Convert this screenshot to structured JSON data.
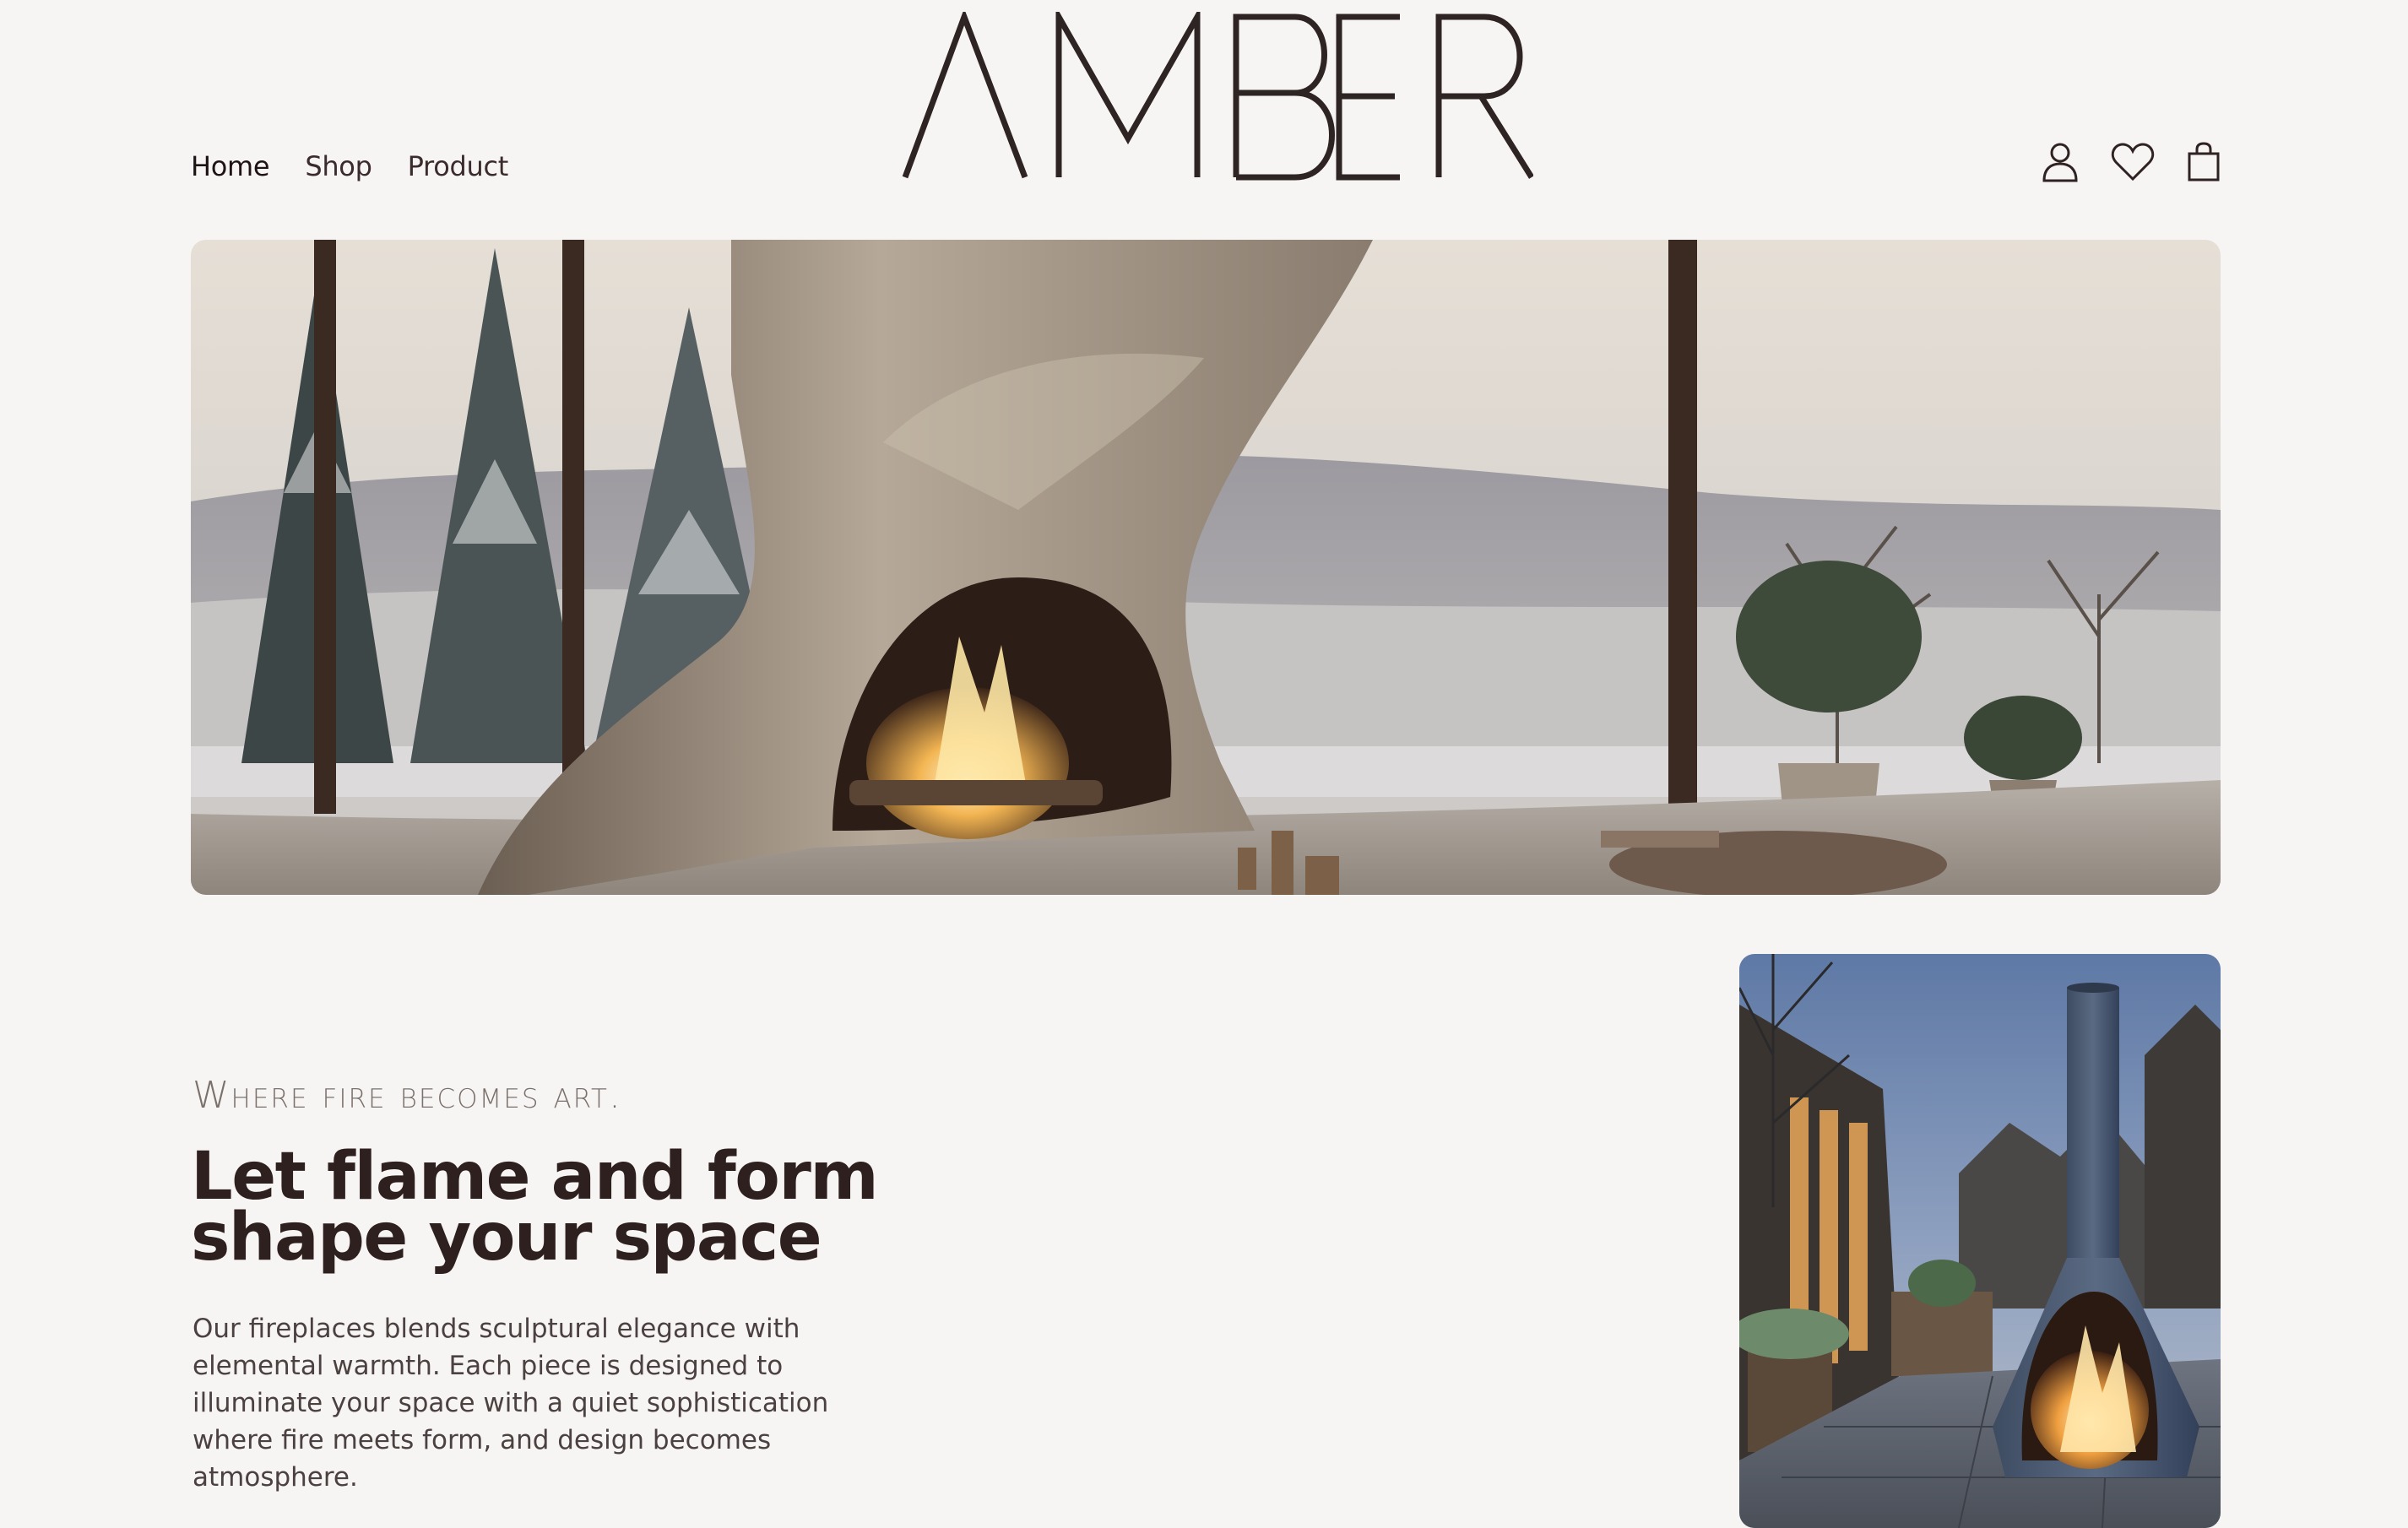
{
  "brand": {
    "logo_text": "AMBER"
  },
  "nav": {
    "items": [
      {
        "label": "Home",
        "active": true
      },
      {
        "label": "Shop",
        "active": false
      },
      {
        "label": "Product",
        "active": false
      }
    ]
  },
  "actions": {
    "icons": [
      "user-icon",
      "heart-icon",
      "shopping-bag-icon"
    ]
  },
  "intro": {
    "tagline": "Where fire becomes art.",
    "headline_line1": "Let flame and form",
    "headline_line2": "shape your space",
    "body": "Our fireplaces blends sculptural elegance with elemental warmth. Each piece is designed to illuminate your space with a quiet sophistication  where fire meets form, and design becomes atmosphere."
  },
  "colors": {
    "background": "#f7f5f3",
    "text_dark": "#2f2020",
    "text_muted": "#7a706c"
  }
}
